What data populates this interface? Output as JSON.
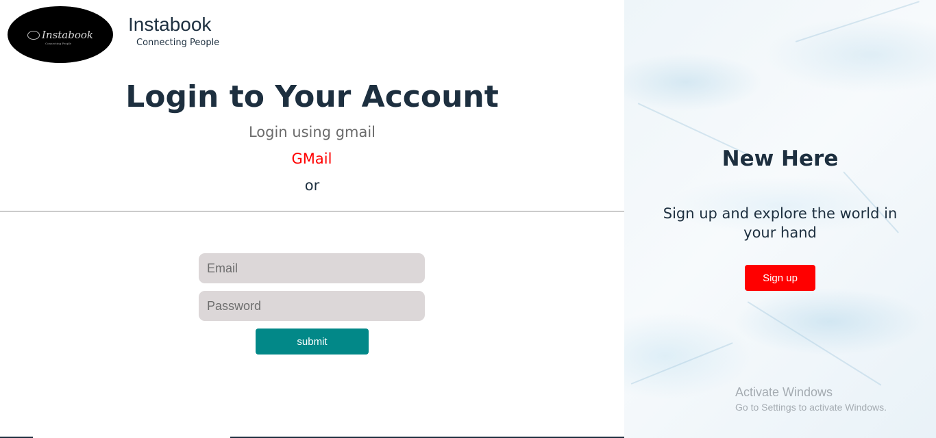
{
  "brand": {
    "name": "Instabook",
    "tagline": "Connecting People",
    "logo_text": "Instabook",
    "logo_subtext": "Connecting People"
  },
  "login": {
    "title": "Login to Your Account",
    "subtitle": "Login using gmail",
    "gmail_link": "GMail",
    "or_text": "or",
    "email_placeholder": "Email",
    "password_placeholder": "Password",
    "submit_label": "submit"
  },
  "signup_panel": {
    "heading": "New Here",
    "text": "Sign up and explore the world in your hand",
    "button_label": "Sign up"
  },
  "watermark": {
    "title": "Activate Windows",
    "subtitle": "Go to Settings to activate Windows."
  },
  "colors": {
    "primary_text": "#1d2f3f",
    "gmail_red": "#ff0000",
    "submit_teal": "#028888",
    "signup_red": "#ff0000",
    "input_bg": "#dcd7d8"
  }
}
